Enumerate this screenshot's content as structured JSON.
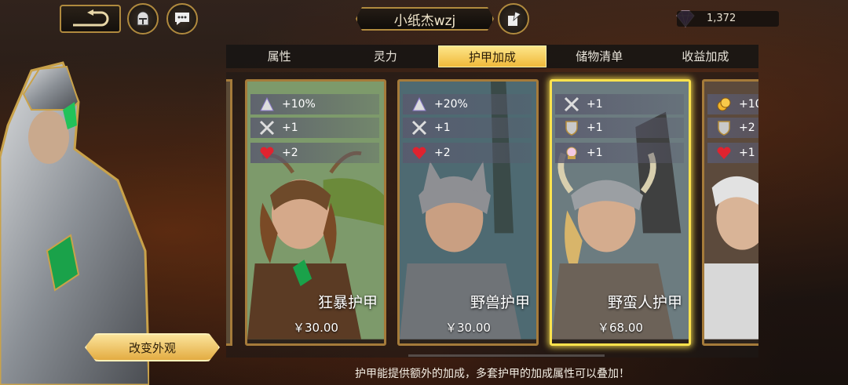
{
  "player": {
    "name": "小纸杰wzj"
  },
  "currency": {
    "gems": "1,372"
  },
  "tabs": [
    {
      "label": "属性"
    },
    {
      "label": "灵力"
    },
    {
      "label": "护甲加成",
      "active": true
    },
    {
      "label": "储物清单"
    },
    {
      "label": "收益加成"
    }
  ],
  "cards": [
    {
      "name": "狂暴护甲",
      "price": "￥30.00",
      "stats": [
        {
          "icon": "crystal-pyramid-icon",
          "value": "+10%"
        },
        {
          "icon": "crossed-swords-icon",
          "value": "+1"
        },
        {
          "icon": "heart-icon",
          "value": "+2"
        }
      ]
    },
    {
      "name": "野兽护甲",
      "price": "￥30.00",
      "stats": [
        {
          "icon": "crystal-pyramid-icon",
          "value": "+20%"
        },
        {
          "icon": "crossed-swords-icon",
          "value": "+1"
        },
        {
          "icon": "heart-icon",
          "value": "+2"
        }
      ]
    },
    {
      "name": "野蛮人护甲",
      "price": "￥68.00",
      "selected": true,
      "stats": [
        {
          "icon": "crossed-swords-icon",
          "value": "+1"
        },
        {
          "icon": "shield-icon",
          "value": "+1"
        },
        {
          "icon": "pearl-icon",
          "value": "+1"
        }
      ]
    },
    {
      "name": "",
      "price": "",
      "stats": [
        {
          "icon": "gold-coins-icon",
          "value": "+10"
        },
        {
          "icon": "shield-icon",
          "value": "+2"
        },
        {
          "icon": "heart-icon",
          "value": "+1"
        }
      ]
    }
  ],
  "change_appearance_label": "改变外观",
  "footer_hint": "护甲能提供额外的加成，多套护甲的加成属性可以叠加！",
  "colors": {
    "gold": "#f0b93a",
    "frame": "#a57b3a",
    "selected": "#ffe34d"
  }
}
